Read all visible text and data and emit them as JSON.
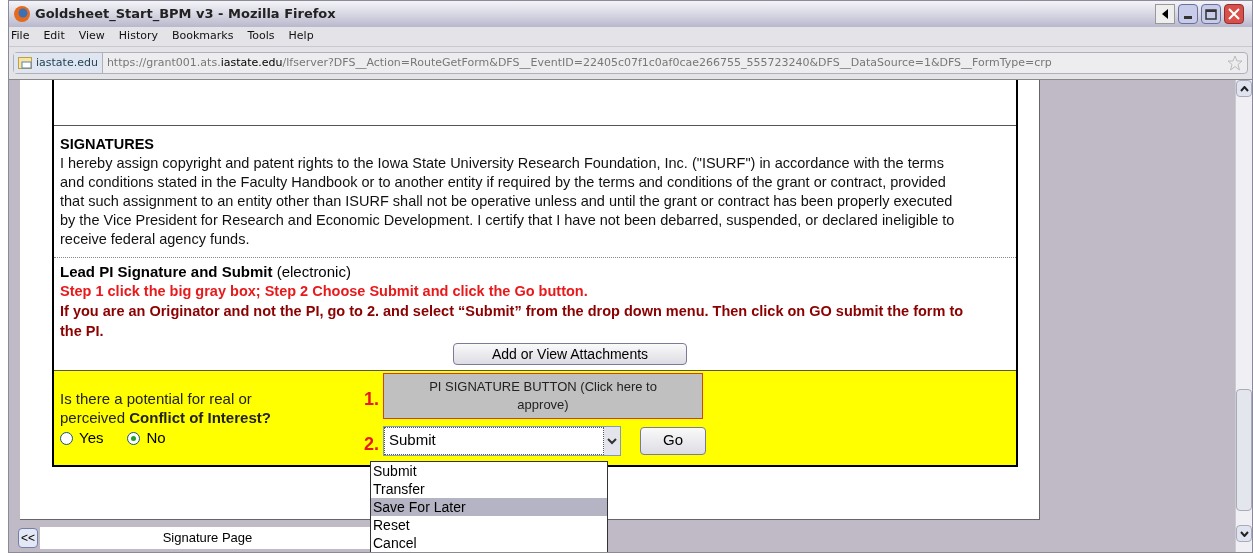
{
  "window": {
    "title": "Goldsheet_Start_BPM v3 - Mozilla Firefox"
  },
  "menu": [
    {
      "label": "File"
    },
    {
      "label": "Edit"
    },
    {
      "label": "View"
    },
    {
      "label": "History"
    },
    {
      "label": "Bookmarks"
    },
    {
      "label": "Tools"
    },
    {
      "label": "Help"
    }
  ],
  "address_bar": {
    "site": "iastate.edu",
    "url_start": "https://grant001.ats.",
    "url_domain": "iastate.edu",
    "url_rest": "/lfserver?DFS__Action=RouteGetForm&DFS__EventID=22405c07f1c0af0cae266755_555723240&DFS__DataSource=1&DFS__FormType=crp"
  },
  "form": {
    "signatures_heading": "SIGNATURES",
    "signatures_text": "I hereby assign copyright and patent rights to the Iowa State University Research Foundation, Inc. (\"ISURF\") in accordance with the terms and conditions stated in the Faculty Handbook or to another entity if required by the terms and conditions of the grant or contract, provided that such assignment to an entity other than ISURF shall not be operative unless and until the grant or contract has been properly executed by the Vice President for Research and Economic Development. I certify that I have not been debarred, suspended, or declared ineligible to receive federal agency funds.",
    "lead_pi_heading": "**Lead PI Signature and Submit** (electronic)",
    "instructions": [
      {
        "text": "Step 1 click the big gray box; Step 2 Choose Submit and click the Go button.",
        "color": "#e8191b"
      },
      {
        "text": "If you are an Originator and not the PI, go to 2. and select “Submit” from the drop down menu. Then click on GO submit the form to the PI.",
        "color": "#8b0000"
      }
    ],
    "attachments_button": "Add or View Attachments",
    "conflict_question": "Is there a potential for real or perceived **Conflict of Interest?**",
    "conflict_options": [
      {
        "label": "Yes",
        "selected": false
      },
      {
        "label": "No",
        "selected": true
      }
    ],
    "step_1": "1.",
    "signature_button": "PI SIGNATURE BUTTON (Click here to approve)",
    "step_2": "2.",
    "action_select": {
      "value": "Submit",
      "expanded": true,
      "options": [
        {
          "label": "Submit",
          "highlighted": false
        },
        {
          "label": "Transfer",
          "highlighted": false
        },
        {
          "label": "Save For Later",
          "highlighted": true
        },
        {
          "label": "Reset",
          "highlighted": false
        },
        {
          "label": "Cancel",
          "highlighted": false
        }
      ]
    },
    "go_button": "Go"
  },
  "page_tabs": {
    "back_button": "<<",
    "tabs": [
      {
        "label": "Signature Page"
      }
    ]
  }
}
